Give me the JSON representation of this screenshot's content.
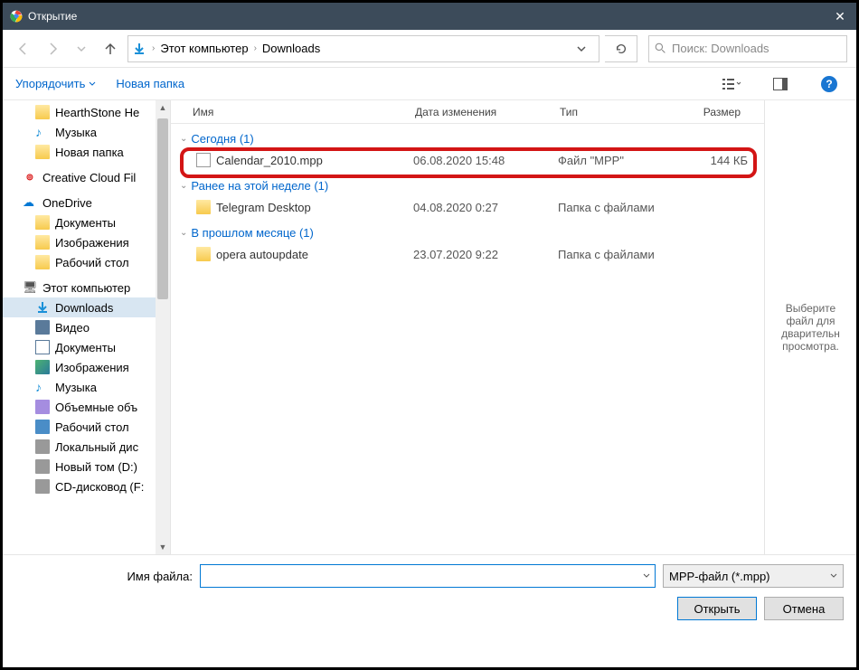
{
  "titlebar": {
    "title": "Открытие"
  },
  "nav": {
    "path_segments": [
      "Этот компьютер",
      "Downloads"
    ],
    "search_placeholder": "Поиск: Downloads"
  },
  "toolbar": {
    "organize": "Упорядочить",
    "new_folder": "Новая папка"
  },
  "sidebar": {
    "items": [
      {
        "label": "HearthStone  He",
        "icon": "folder",
        "indent": 1
      },
      {
        "label": "Музыка",
        "icon": "music",
        "indent": 1
      },
      {
        "label": "Новая папка",
        "icon": "folder",
        "indent": 1
      },
      {
        "label": "Creative Cloud Fil",
        "icon": "cc",
        "indent": 0,
        "root": true
      },
      {
        "label": "OneDrive",
        "icon": "onedrive",
        "indent": 0,
        "root": true
      },
      {
        "label": "Документы",
        "icon": "folder",
        "indent": 1
      },
      {
        "label": "Изображения",
        "icon": "folder",
        "indent": 1
      },
      {
        "label": "Рабочий стол",
        "icon": "folder",
        "indent": 1
      },
      {
        "label": "Этот компьютер",
        "icon": "pc",
        "indent": 0,
        "root": true
      },
      {
        "label": "Downloads",
        "icon": "down",
        "indent": 1,
        "selected": true
      },
      {
        "label": "Видео",
        "icon": "video",
        "indent": 1
      },
      {
        "label": "Документы",
        "icon": "docs",
        "indent": 1
      },
      {
        "label": "Изображения",
        "icon": "imgs",
        "indent": 1
      },
      {
        "label": "Музыка",
        "icon": "music",
        "indent": 1
      },
      {
        "label": "Объемные объ",
        "icon": "obj",
        "indent": 1
      },
      {
        "label": "Рабочий стол",
        "icon": "desk",
        "indent": 1
      },
      {
        "label": "Локальный дис",
        "icon": "disk",
        "indent": 1
      },
      {
        "label": "Новый том (D:)",
        "icon": "disk",
        "indent": 1
      },
      {
        "label": "CD-дисковод (F:",
        "icon": "disk",
        "indent": 1
      }
    ]
  },
  "columns": {
    "name": "Имя",
    "date": "Дата изменения",
    "type": "Тип",
    "size": "Размер"
  },
  "groups": [
    {
      "header": "Сегодня (1)",
      "items": [
        {
          "name": "Calendar_2010.mpp",
          "date": "06.08.2020 15:48",
          "type": "Файл \"MPP\"",
          "size": "144 КБ",
          "icon": "file",
          "highlighted": true
        }
      ]
    },
    {
      "header": "Ранее на этой неделе (1)",
      "items": [
        {
          "name": "Telegram Desktop",
          "date": "04.08.2020 0:27",
          "type": "Папка с файлами",
          "size": "",
          "icon": "folder"
        }
      ]
    },
    {
      "header": "В прошлом месяце (1)",
      "items": [
        {
          "name": "opera autoupdate",
          "date": "23.07.2020 9:22",
          "type": "Папка с файлами",
          "size": "",
          "icon": "folder"
        }
      ]
    }
  ],
  "preview": {
    "text": "Выберите файл для дварительн просмотра."
  },
  "footer": {
    "filename_label": "Имя файла:",
    "filename_value": "",
    "filter": "MPP-файл (*.mpp)",
    "open": "Открыть",
    "cancel": "Отмена"
  }
}
